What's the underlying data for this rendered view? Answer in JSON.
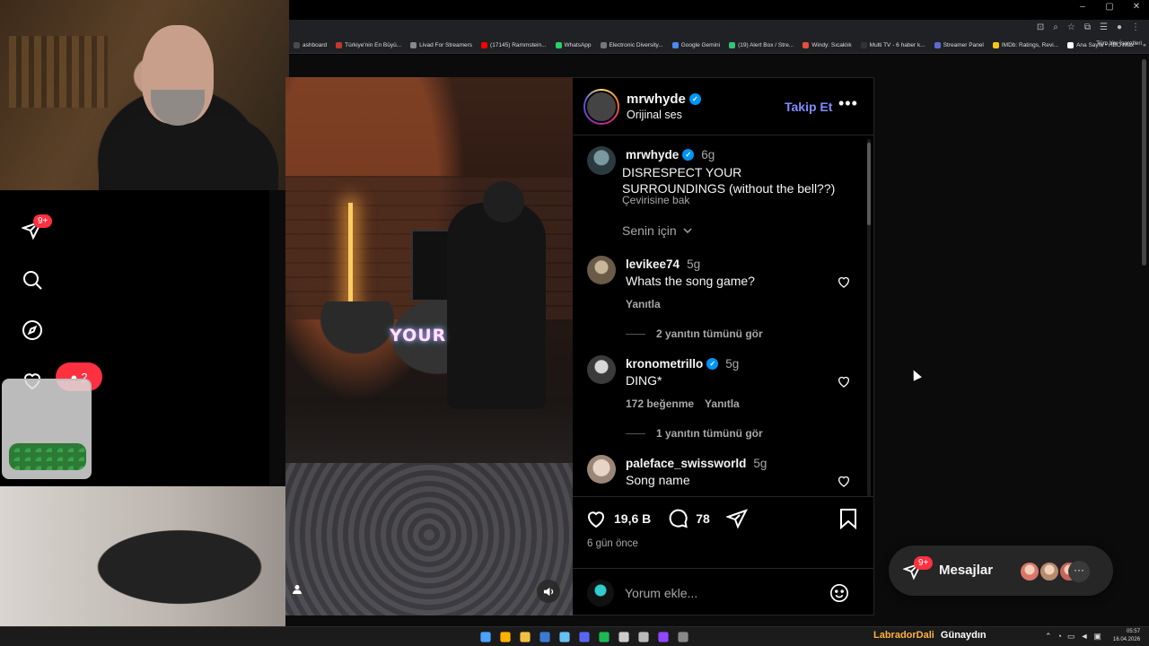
{
  "browser": {
    "window_controls": [
      "–",
      "▢",
      "✕"
    ],
    "bookmarks": [
      {
        "label": "ashboard",
        "color": "#4a4a4a"
      },
      {
        "label": "Türkiye'nin En Büyü...",
        "color": "#c0392b"
      },
      {
        "label": "Livad For Streamers",
        "color": "#888888"
      },
      {
        "label": "(17145) Rammstein...",
        "color": "#ff0000"
      },
      {
        "label": "WhatsApp",
        "color": "#25d366"
      },
      {
        "label": "Electronic Diversity...",
        "color": "#777777"
      },
      {
        "label": "Google Gemini",
        "color": "#4a8af4"
      },
      {
        "label": "(19) Alert Box / Stre...",
        "color": "#31c27c"
      },
      {
        "label": "Windy: Sıcaklık",
        "color": "#e74c3c"
      },
      {
        "label": "Multi TV - 6 haber k...",
        "color": "#333333"
      },
      {
        "label": "Streamer Panel",
        "color": "#5b6bd6"
      },
      {
        "label": "IMDb: Ratings, Revi...",
        "color": "#f5c518"
      },
      {
        "label": "Ana Sayfa • HBO Max",
        "color": "#ffffff"
      }
    ],
    "bookmarks_overflow": "»",
    "all_bookmarks": "Tüm Yer İşaretleri"
  },
  "leftnav": {
    "messages_badge": "9+",
    "notif_count": "2"
  },
  "video": {
    "caption_overlay": "YOUR"
  },
  "post": {
    "username": "mrwhyde",
    "audio": "Orijinal ses",
    "follow_label": "Takip Et",
    "more_label": "•••",
    "caption_user": "mrwhyde",
    "caption_time": "6g",
    "caption_text": "DISRESPECT YOUR SURROUNDINGS (without the bell??)",
    "translate_label": "Çevirisine bak",
    "sort_label": "Senin için",
    "comments": [
      {
        "user": "levikee74",
        "time": "5g",
        "text": "Whats the song game?",
        "likes": "",
        "reply_label": "Yanıtla",
        "view_replies": "2 yanıtın tümünü gör",
        "verified": false
      },
      {
        "user": "kronometrillo",
        "time": "5g",
        "text": "DING*",
        "likes": "172 beğenme",
        "reply_label": "Yanıtla",
        "view_replies": "1 yanıtın tümünü gör",
        "verified": true
      },
      {
        "user": "paleface_swissworld",
        "time": "5g",
        "text": "Song name",
        "likes": "",
        "reply_label": "",
        "view_replies": "",
        "verified": false
      }
    ],
    "like_count": "19,6 B",
    "comment_count": "78",
    "posted_ago": "6 gün önce",
    "comment_placeholder": "Yorum ekle..."
  },
  "messages_bar": {
    "badge": "9+",
    "label": "Mesajlar",
    "more": "···",
    "avatar_colors": [
      "#d9776a",
      "#b58a6e",
      "#c9645a"
    ]
  },
  "taskbar": {
    "icon_colors": [
      "#4aa3ff",
      "#ffb300",
      "#f0c040",
      "#3a7bd5",
      "#66c0f4",
      "#5865f2",
      "#1db954",
      "#cccccc",
      "#bbbbbb",
      "#9146ff",
      "#888888"
    ],
    "weather_city": "LabradorDali",
    "weather_greeting": "Günaydın",
    "time": "05:57",
    "date": "16.04.2026"
  },
  "colors": {
    "accent_link": "#828aff",
    "verified": "#0095f6",
    "badge": "#ff3040"
  }
}
